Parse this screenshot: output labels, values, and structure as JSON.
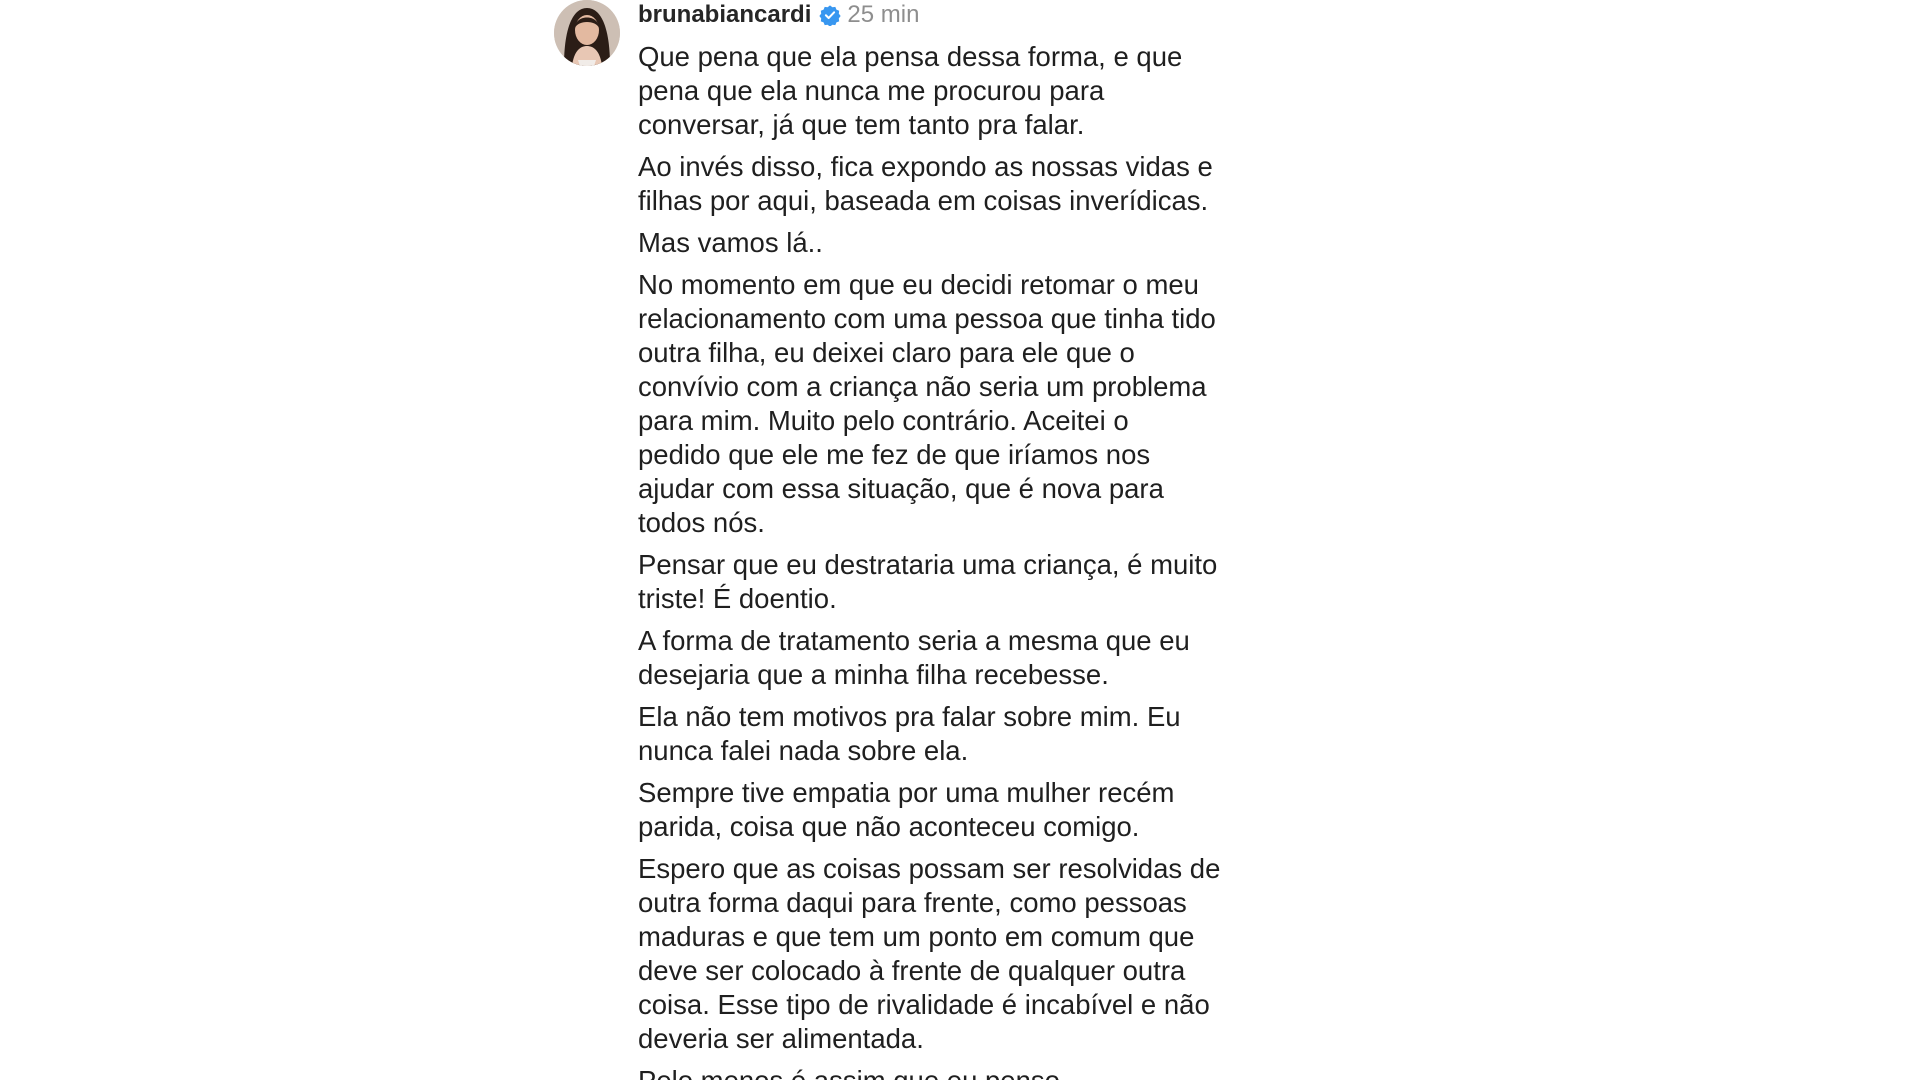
{
  "comment": {
    "username": "brunabiancardi",
    "verified_icon": "verified-badge-icon",
    "time": "25 min",
    "avatar_icon": "profile-avatar",
    "accent_color": "#3897f0",
    "paragraphs": [
      "Que pena que ela pensa dessa forma, e que\npena que ela nunca me procurou para\nconversar, já que tem tanto pra falar.",
      "Ao invés disso, fica expondo as nossas vidas e\nfilhas por aqui, baseada em coisas inverídicas.",
      "Mas vamos lá..",
      "No momento em que eu decidi retomar o meu\nrelacionamento com uma pessoa que tinha tido\noutra filha, eu deixei claro para ele que o\nconvívio com a criança não seria um problema\npara mim. Muito pelo contrário. Aceitei o\npedido que ele me fez de que iríamos nos\najudar com essa situação, que é nova para\ntodos nós.",
      "Pensar que eu destrataria uma criança, é muito\ntriste! É doentio.",
      "A forma de tratamento seria a mesma que eu\ndesejaria que a minha filha recebesse.",
      "Ela não tem motivos pra falar sobre mim. Eu\nnunca falei nada sobre ela.",
      "Sempre tive empatia por uma mulher recém\nparida, coisa que não aconteceu comigo.",
      "Espero que as coisas possam ser resolvidas de\noutra forma daqui para frente, como pessoas\nmaduras e que tem um ponto em comum que\ndeve ser colocado à frente de qualquer outra\ncoisa. Esse tipo de rivalidade é incabível e não\ndeveria ser alimentada.",
      "Pelo menos é assim que eu penso."
    ]
  }
}
